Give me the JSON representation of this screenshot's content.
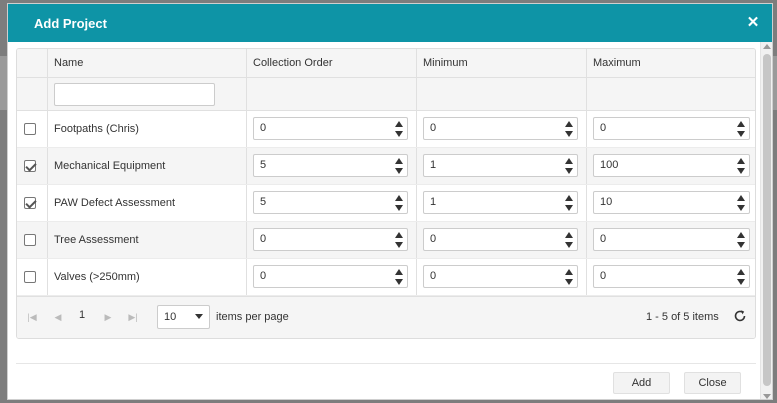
{
  "dialog": {
    "title": "Add Project",
    "close_icon": "close-icon"
  },
  "columns": [
    "Name",
    "Collection Order",
    "Minimum",
    "Maximum"
  ],
  "rows": [
    {
      "checked": false,
      "name": "Footpaths (Chris)",
      "order": "0",
      "min": "0",
      "max": "0"
    },
    {
      "checked": true,
      "name": "Mechanical Equipment",
      "order": "5",
      "min": "1",
      "max": "100"
    },
    {
      "checked": true,
      "name": "PAW Defect Assessment",
      "order": "5",
      "min": "1",
      "max": "10"
    },
    {
      "checked": false,
      "name": "Tree Assessment",
      "order": "0",
      "min": "0",
      "max": "0"
    },
    {
      "checked": false,
      "name": "Valves (>250mm)",
      "order": "0",
      "min": "0",
      "max": "0"
    }
  ],
  "pager": {
    "current_page": "1",
    "page_size": "10",
    "items_per_page_label": "items per page",
    "info": "1 - 5 of 5 items"
  },
  "buttons": {
    "add": "Add",
    "close": "Close"
  },
  "colors": {
    "titlebar": "#0e94a6",
    "alt_row": "#f5f5f5"
  }
}
